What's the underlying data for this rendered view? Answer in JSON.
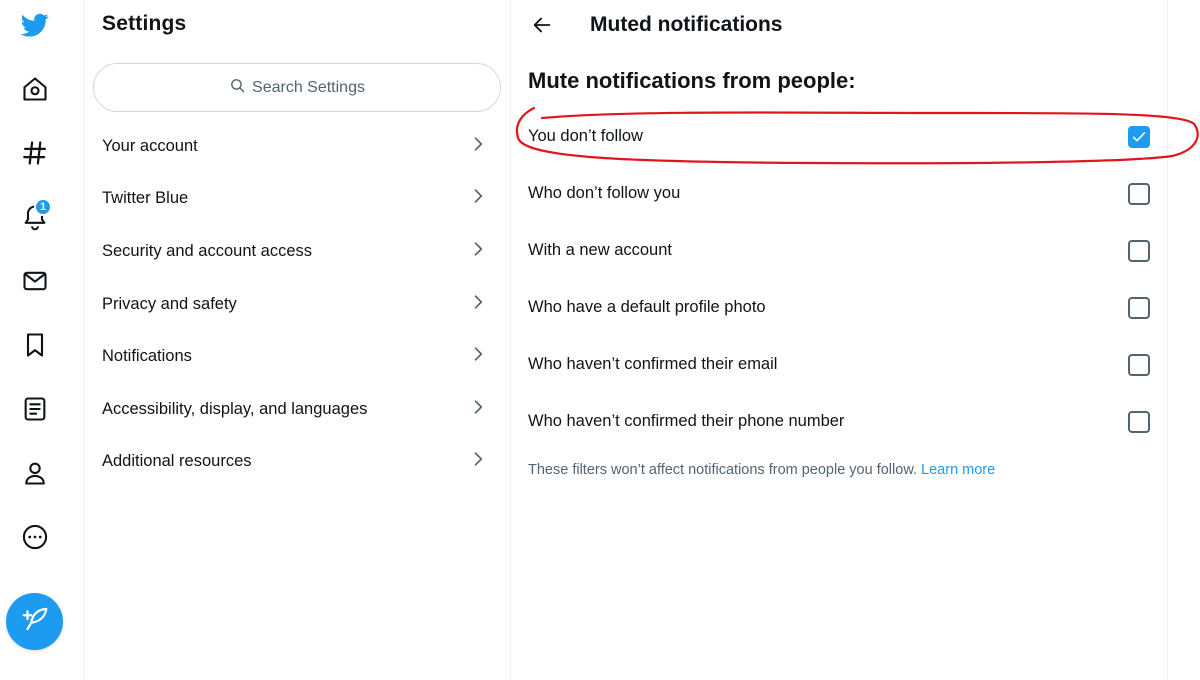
{
  "colors": {
    "brand": "#1d9bf0",
    "annotation": "#e0161d"
  },
  "nav": {
    "items": [
      {
        "icon": "twitter-bird-icon"
      },
      {
        "icon": "home-icon"
      },
      {
        "icon": "explore-hashtag-icon"
      },
      {
        "icon": "notifications-bell-icon",
        "badge": "1"
      },
      {
        "icon": "messages-envelope-icon"
      },
      {
        "icon": "bookmarks-icon"
      },
      {
        "icon": "lists-icon"
      },
      {
        "icon": "profile-icon"
      },
      {
        "icon": "more-icon"
      }
    ],
    "compose_icon": "compose-feather-icon"
  },
  "settings": {
    "title": "Settings",
    "search_placeholder": "Search Settings",
    "menu": [
      {
        "label": "Your account"
      },
      {
        "label": "Twitter Blue"
      },
      {
        "label": "Security and account access"
      },
      {
        "label": "Privacy and safety"
      },
      {
        "label": "Notifications"
      },
      {
        "label": "Accessibility, display, and languages"
      },
      {
        "label": "Additional resources"
      }
    ]
  },
  "detail": {
    "title": "Muted notifications",
    "heading": "Mute notifications from people:",
    "options": [
      {
        "label": "You don’t follow",
        "checked": true
      },
      {
        "label": "Who don’t follow you",
        "checked": false
      },
      {
        "label": "With a new account",
        "checked": false
      },
      {
        "label": "Who have a default profile photo",
        "checked": false
      },
      {
        "label": "Who haven’t confirmed their email",
        "checked": false
      },
      {
        "label": "Who haven’t confirmed their phone number",
        "checked": false
      }
    ],
    "footnote": "These filters won’t affect notifications from people you follow.",
    "learn_more": "Learn more"
  }
}
